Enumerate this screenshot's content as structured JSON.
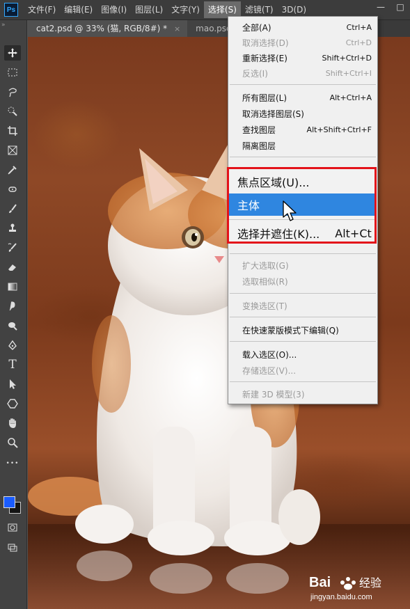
{
  "app": {
    "logo": "Ps"
  },
  "menubar": {
    "items": [
      {
        "label": "文件(F)"
      },
      {
        "label": "编辑(E)"
      },
      {
        "label": "图像(I)"
      },
      {
        "label": "图层(L)"
      },
      {
        "label": "文字(Y)"
      },
      {
        "label": "选择(S)"
      },
      {
        "label": "滤镜(T)"
      },
      {
        "label": "3D(D)"
      }
    ],
    "active_index": 5
  },
  "window_controls": {
    "minimize": "—",
    "restore": "□"
  },
  "tabs": [
    {
      "label": "cat2.psd @ 33% (猫, RGB/8#) *",
      "close": "×",
      "active": true
    },
    {
      "label": "mao.psd",
      "close": "",
      "active": false
    }
  ],
  "toolbar": {
    "collapse_glyph": "»",
    "tools": [
      {
        "icon": "move-icon",
        "selected": true
      },
      {
        "icon": "marquee-icon"
      },
      {
        "icon": "lasso-icon"
      },
      {
        "icon": "quick-selection-icon"
      },
      {
        "icon": "crop-icon"
      },
      {
        "icon": "frame-icon"
      },
      {
        "icon": "eyedropper-icon"
      },
      {
        "icon": "healing-brush-icon"
      },
      {
        "icon": "brush-icon"
      },
      {
        "icon": "clone-stamp-icon"
      },
      {
        "icon": "history-brush-icon"
      },
      {
        "icon": "eraser-icon"
      },
      {
        "icon": "gradient-icon"
      },
      {
        "icon": "blur-icon"
      },
      {
        "icon": "dodge-icon"
      },
      {
        "icon": "pen-icon"
      },
      {
        "icon": "type-icon",
        "glyph": "T"
      },
      {
        "icon": "path-selection-icon"
      },
      {
        "icon": "shape-icon"
      },
      {
        "icon": "hand-icon"
      },
      {
        "icon": "zoom-icon"
      },
      {
        "icon": "more-tools-icon",
        "glyph": "•••"
      }
    ],
    "foreground_color": "#1a5cff",
    "background_color": "#141414"
  },
  "select_menu": {
    "items": [
      {
        "label": "全部(A)",
        "shortcut": "Ctrl+A",
        "disabled": false
      },
      {
        "label": "取消选择(D)",
        "shortcut": "Ctrl+D",
        "disabled": true
      },
      {
        "label": "重新选择(E)",
        "shortcut": "Shift+Ctrl+D",
        "disabled": false
      },
      {
        "label": "反选(I)",
        "shortcut": "Shift+Ctrl+I",
        "disabled": true
      },
      {
        "label": "所有图层(L)",
        "shortcut": "Alt+Ctrl+A",
        "disabled": false
      },
      {
        "label": "取消选择图层(S)",
        "shortcut": "",
        "disabled": false
      },
      {
        "label": "查找图层",
        "shortcut": "Alt+Shift+Ctrl+F",
        "disabled": false
      },
      {
        "label": "隔离图层",
        "shortcut": "",
        "disabled": false
      },
      {
        "label": "扩大选取(G)",
        "shortcut": "",
        "disabled": true
      },
      {
        "label": "选取相似(R)",
        "shortcut": "",
        "disabled": true
      },
      {
        "label": "变换选区(T)",
        "shortcut": "",
        "disabled": true
      },
      {
        "label": "在快速蒙版模式下编辑(Q)",
        "shortcut": "",
        "disabled": false
      },
      {
        "label": "载入选区(O)...",
        "shortcut": "",
        "disabled": false
      },
      {
        "label": "存储选区(V)...",
        "shortcut": "",
        "disabled": true
      },
      {
        "label": "新建 3D 模型(3)",
        "shortcut": "",
        "disabled": true
      }
    ],
    "highlight_box": {
      "items": [
        {
          "label": "焦点区域(U)...",
          "shortcut": "",
          "highlighted": false
        },
        {
          "label": "主体",
          "shortcut": "",
          "highlighted": true
        },
        {
          "label": "选择并遮住(K)...",
          "shortcut": "Alt+Ct",
          "highlighted": false
        }
      ],
      "border_color": "#e3121a",
      "highlight_color": "#2f86e0"
    }
  },
  "watermark": {
    "brand": "Bai",
    "brand_suffix": "经验",
    "url": "jingyan.baidu.com"
  }
}
